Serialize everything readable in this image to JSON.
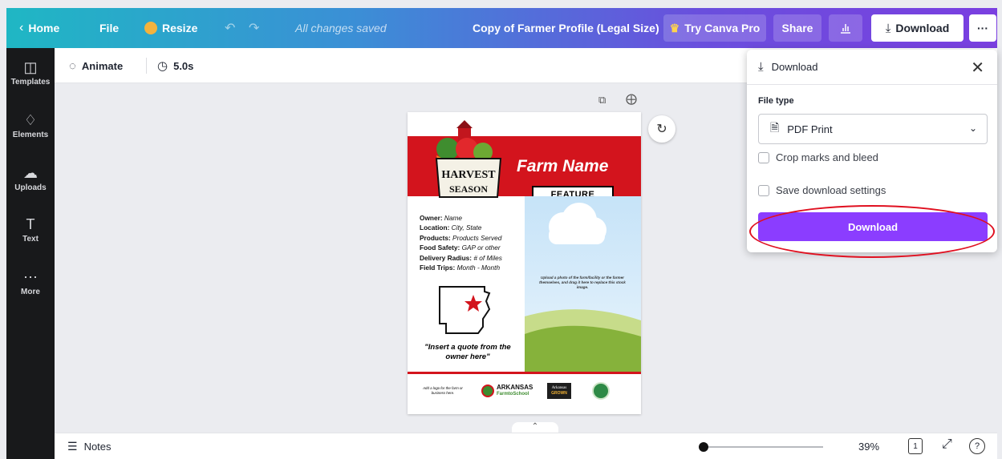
{
  "topbar": {
    "home": "Home",
    "file": "File",
    "resize": "Resize",
    "saved": "All changes saved",
    "doc_title": "Copy of Farmer Profile (Legal Size)",
    "try_pro": "Try Canva Pro",
    "share": "Share",
    "download": "Download",
    "more": "···",
    "gradient_colors": [
      "#1fb7c4",
      "#3b8fd6",
      "#6a4fdd",
      "#7a3fe0"
    ]
  },
  "sidebar": {
    "items": [
      {
        "label": "Templates",
        "icon": "templates-icon"
      },
      {
        "label": "Elements",
        "icon": "elements-icon"
      },
      {
        "label": "Uploads",
        "icon": "uploads-icon"
      },
      {
        "label": "Text",
        "icon": "text-icon"
      },
      {
        "label": "More",
        "icon": "more-icon"
      }
    ]
  },
  "toolbar": {
    "animate": "Animate",
    "duration": "5.0s"
  },
  "design": {
    "farm_name": "Farm Name",
    "feature": "FEATURE",
    "logo_harvest": "HARVEST",
    "logo_season": "SEASON",
    "details": [
      {
        "key": "Owner:",
        "value": "Name"
      },
      {
        "key": "Location:",
        "value": "City, State"
      },
      {
        "key": "Products:",
        "value": "Products Served"
      },
      {
        "key": "Food Safety:",
        "value": "GAP or other"
      },
      {
        "key": "Delivery Radius:",
        "value": "# of Miles"
      },
      {
        "key": "Field Trips:",
        "value": "Month - Month"
      }
    ],
    "quote": "\"Insert a quote from the owner here\"",
    "photo_hint": "Upload a photo of the farm/facility or the farmer themselves, and drag it here to replace this stock image.",
    "logo_hint": "Add a logo for the farm or business here.",
    "logo_arkansas": "ARKANSAS",
    "logo_f2s": "FarmtoSchool",
    "logo_grown_top": "Arkansas",
    "logo_grown_bottom": "GROWN",
    "red": "#d3141d"
  },
  "download_panel": {
    "title": "Download",
    "file_type_label": "File type",
    "file_type_value": "PDF Print",
    "crop_marks": "Crop marks and bleed",
    "save_settings": "Save download settings",
    "button": "Download",
    "button_color": "#8b3dff"
  },
  "bottombar": {
    "notes": "Notes",
    "zoom": "39%",
    "page_number": "1"
  }
}
